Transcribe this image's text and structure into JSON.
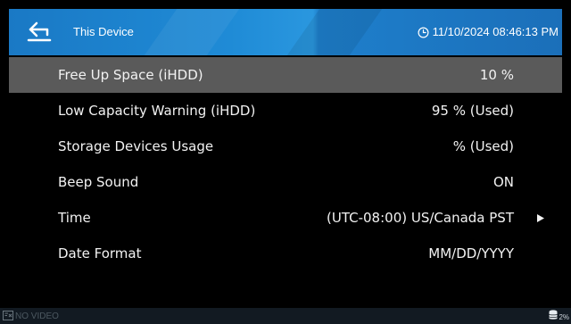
{
  "header": {
    "back_icon": "back-arrow-icon",
    "title": "This Device",
    "clock_icon": "clock-icon",
    "datetime": "11/10/2024 08:46:13 PM",
    "accent_color": "#1f8bd6"
  },
  "settings": {
    "selected_row": 0,
    "selected_color": "#5a5a5a",
    "rows": [
      {
        "label": "Free Up Space (iHDD)",
        "value": "10 %"
      },
      {
        "label": "Low Capacity Warning (iHDD)",
        "value": "95 % (Used)"
      },
      {
        "label": "Storage Devices Usage",
        "value": "% (Used)"
      },
      {
        "label": "Beep Sound",
        "value": "ON"
      },
      {
        "label": "Time",
        "value": "(UTC-08:00) US/Canada PST",
        "arrow_icon": "chevron-right-icon"
      },
      {
        "label": "Date Format",
        "value": "MM/DD/YYYY"
      }
    ]
  },
  "status_bar": {
    "no_video_icon": "no-video-icon",
    "no_video_text": "NO VIDEO",
    "storage_icon": "storage-icon",
    "storage_text": "2%"
  }
}
